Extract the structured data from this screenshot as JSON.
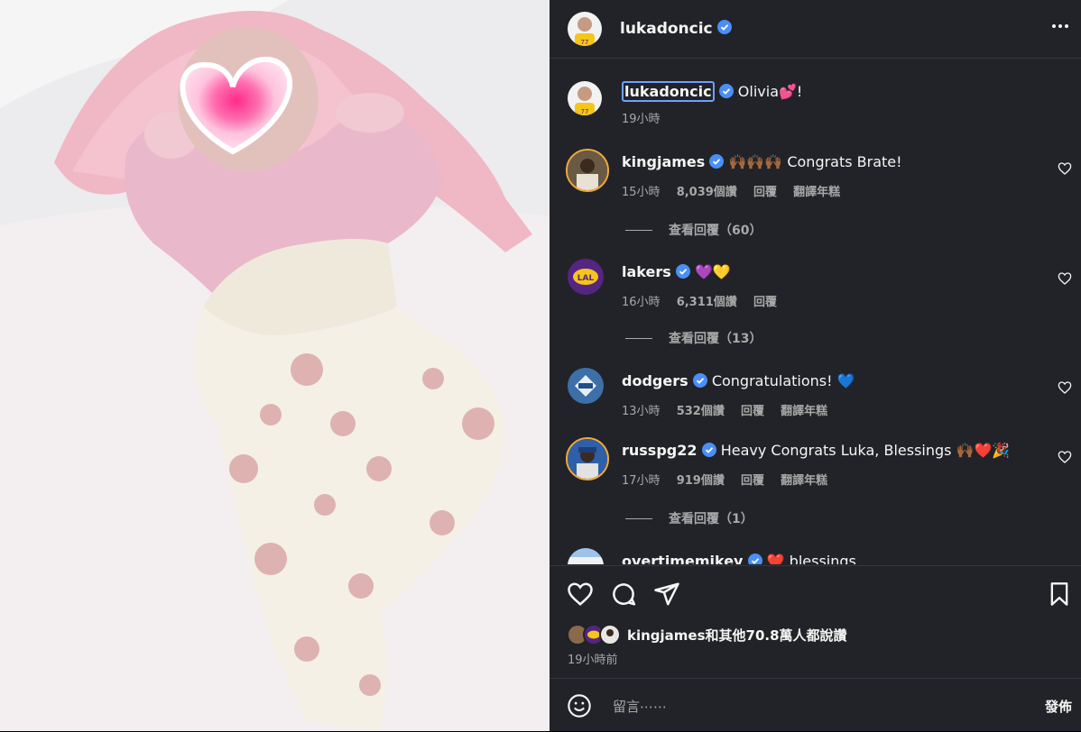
{
  "post": {
    "author": "lukadoncic",
    "caption": {
      "user": "lukadoncic",
      "text": "Olivia💕!",
      "time": "19小時"
    }
  },
  "comments": [
    {
      "user": "kingjames",
      "text": "🙌🏾🙌🏾🙌🏾 Congrats Brate!",
      "time": "15小時",
      "likes": "8,039個讚",
      "reply": "回覆",
      "translate": "翻譯年糕",
      "view_replies": "查看回覆（60）"
    },
    {
      "user": "lakers",
      "text": "💜💛",
      "time": "16小時",
      "likes": "6,311個讚",
      "reply": "回覆",
      "view_replies": "查看回覆（13）"
    },
    {
      "user": "dodgers",
      "text": "Congratulations! 💙",
      "time": "13小時",
      "likes": "532個讚",
      "reply": "回覆",
      "translate": "翻譯年糕"
    },
    {
      "user": "russpg22",
      "text": "Heavy Congrats Luka, Blessings 🙌🏾❤️🎉",
      "time": "17小時",
      "likes": "919個讚",
      "reply": "回覆",
      "translate": "翻譯年糕",
      "view_replies": "查看回覆（1）"
    },
    {
      "user": "overtimemikey",
      "text": "❤️ blessings"
    }
  ],
  "likes_summary": "kingjames和其他70.8萬人都說讚",
  "post_time": "19小時前",
  "composer": {
    "placeholder": "留言⋯⋯",
    "post_label": "發佈"
  },
  "colors": {
    "panel_bg": "#212328",
    "verified": "#4a8ff7",
    "text_secondary": "#a8a8a8"
  },
  "icons": [
    "more-icon",
    "heart-icon",
    "comment-icon",
    "share-icon",
    "bookmark-icon",
    "emoji-icon",
    "verified-icon"
  ]
}
